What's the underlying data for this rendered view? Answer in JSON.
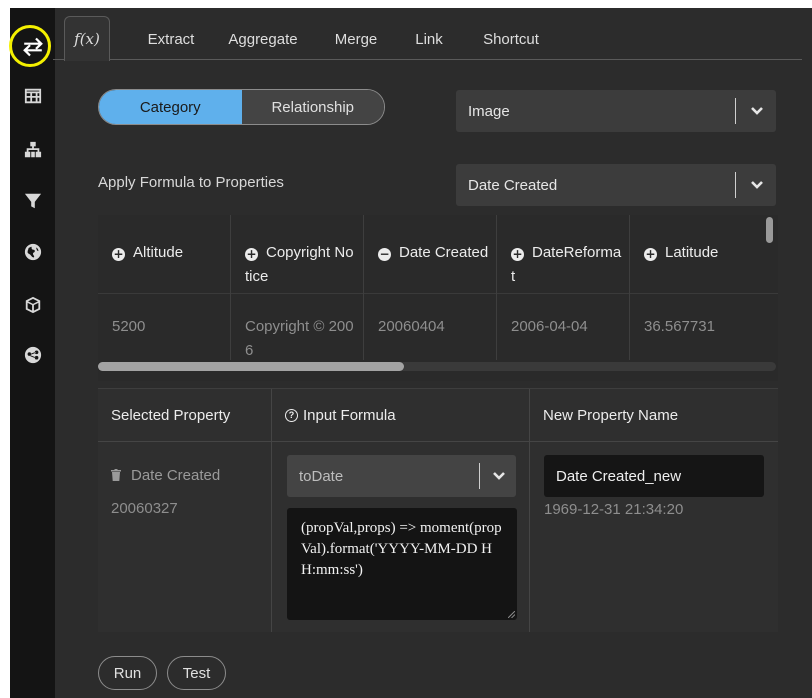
{
  "tabs": [
    {
      "label": "f(x)",
      "active": true
    },
    {
      "label": "Extract"
    },
    {
      "label": "Aggregate"
    },
    {
      "label": "Merge"
    },
    {
      "label": "Link"
    },
    {
      "label": "Shortcut"
    }
  ],
  "segment": {
    "left": "Category",
    "right": "Relationship",
    "selected": "Category"
  },
  "category_select": {
    "value": "Image"
  },
  "apply_label": "Apply Formula to Properties",
  "property_select": {
    "value": "Date Created"
  },
  "properties": [
    {
      "name": "Altitude",
      "icon": "plus-circle-icon",
      "value": "5200"
    },
    {
      "name": "Copyright Notice",
      "icon": "plus-circle-icon",
      "value": "Copyright © 2006"
    },
    {
      "name": "Date Created",
      "icon": "minus-circle-icon",
      "value": "20060404"
    },
    {
      "name": "DateReformat",
      "icon": "plus-circle-icon",
      "value": "2006-04-04"
    },
    {
      "name": "Latitude",
      "icon": "plus-circle-icon",
      "value": "36.567731"
    }
  ],
  "formula": {
    "col_selected": "Selected Property",
    "col_input": "Input Formula",
    "col_new": "New Property Name",
    "selected_property": "Date Created",
    "selected_value": "20060327",
    "function": "toDate",
    "code": "(propVal,props) => moment(propVal).format('YYYY-MM-DD HH:mm:ss')",
    "new_name": "Date Created_new",
    "preview": "1969-12-31 21:34:20"
  },
  "actions": {
    "run": "Run",
    "test": "Test"
  },
  "colors": {
    "accent": "#5fb0ec",
    "highlight": "#f4f000",
    "panel": "#2c2c2c",
    "rail": "#141414"
  }
}
